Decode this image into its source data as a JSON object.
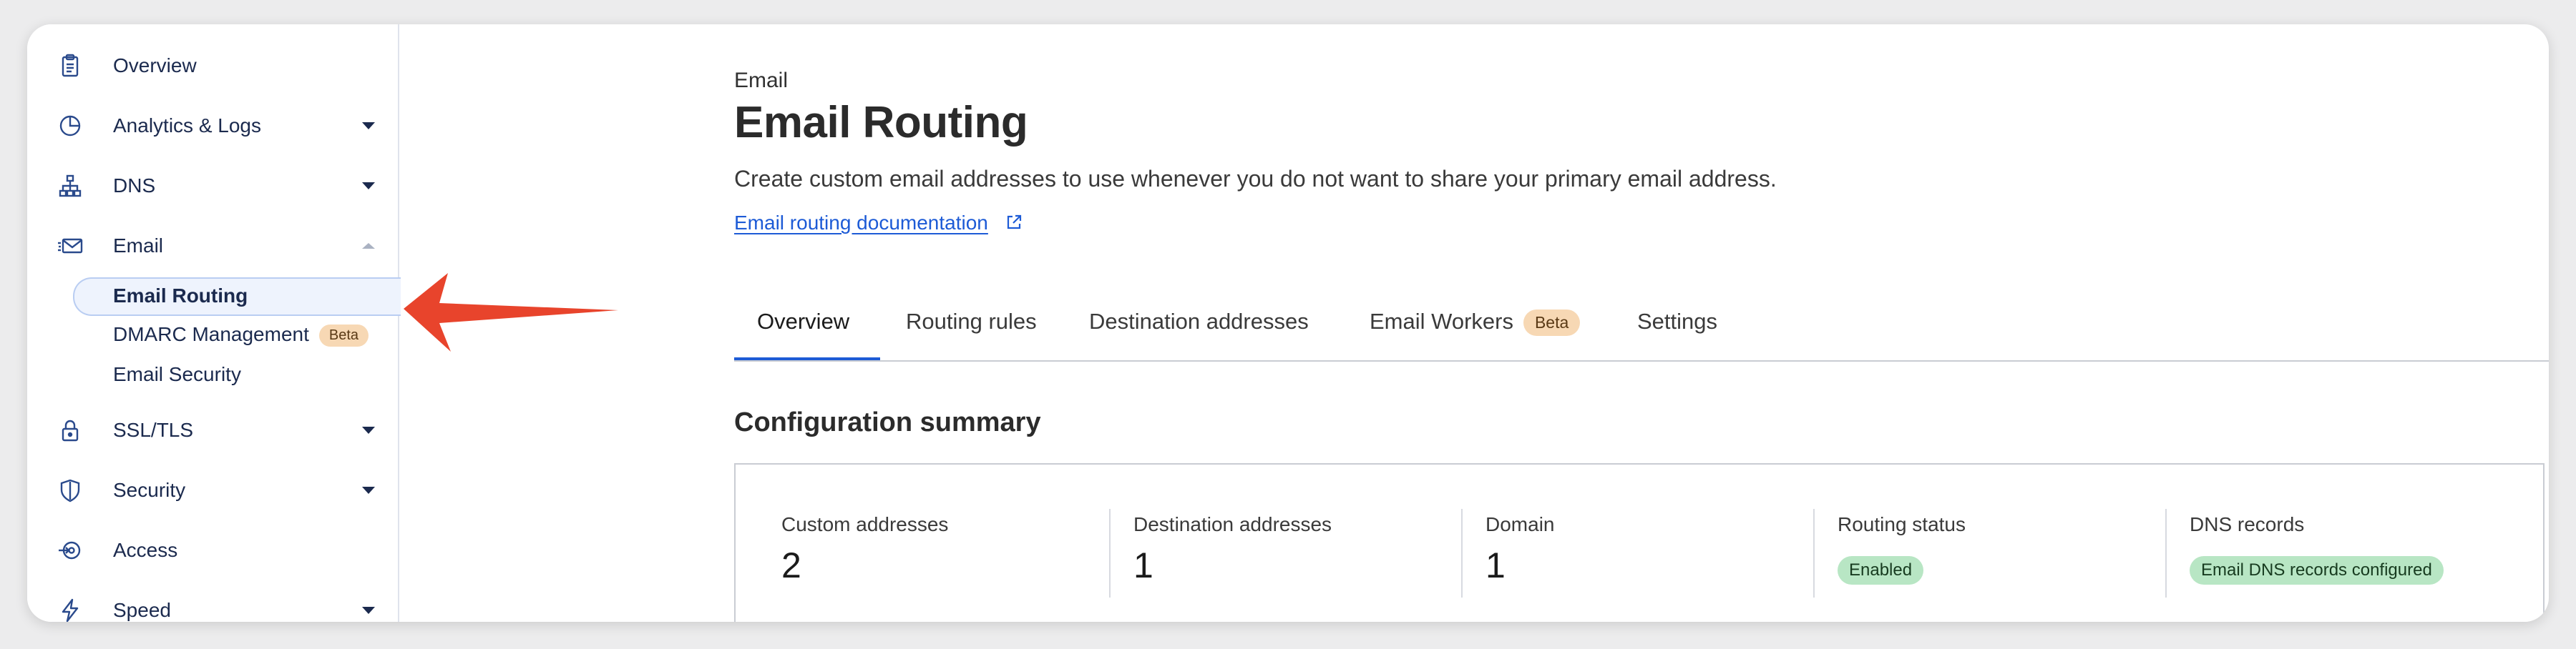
{
  "sidebar": {
    "items": [
      {
        "label": "Overview",
        "icon": "clipboard-icon"
      },
      {
        "label": "Analytics & Logs",
        "icon": "pie-chart-icon"
      },
      {
        "label": "DNS",
        "icon": "network-icon"
      },
      {
        "label": "Email",
        "icon": "email-icon"
      },
      {
        "label": "SSL/TLS",
        "icon": "lock-icon"
      },
      {
        "label": "Security",
        "icon": "shield-icon"
      },
      {
        "label": "Access",
        "icon": "access-icon"
      },
      {
        "label": "Speed",
        "icon": "lightning-icon"
      }
    ],
    "email_sub": {
      "routing": "Email Routing",
      "dmarc": "DMARC Management",
      "dmarc_badge": "Beta",
      "security": "Email Security"
    }
  },
  "main": {
    "eyebrow": "Email",
    "title": "Email Routing",
    "description": "Create custom email addresses to use whenever you do not want to share your primary email address.",
    "doc_link": "Email routing documentation",
    "tabs": [
      {
        "label": "Overview"
      },
      {
        "label": "Routing rules"
      },
      {
        "label": "Destination addresses"
      },
      {
        "label": "Email Workers",
        "badge": "Beta"
      },
      {
        "label": "Settings"
      }
    ],
    "section_title": "Configuration summary",
    "summary": {
      "custom_addresses": {
        "label": "Custom addresses",
        "value": "2"
      },
      "destination_addresses": {
        "label": "Destination addresses",
        "value": "1"
      },
      "domain": {
        "label": "Domain",
        "value": "1"
      },
      "routing_status": {
        "label": "Routing status",
        "value": "Enabled"
      },
      "dns_records": {
        "label": "DNS records",
        "value": "Email DNS records configured"
      }
    }
  },
  "colors": {
    "accent": "#1d5bd6",
    "arrow": "#e8442c",
    "badge_green": "#b8e6c4",
    "badge_beta": "#f7d8b4"
  }
}
